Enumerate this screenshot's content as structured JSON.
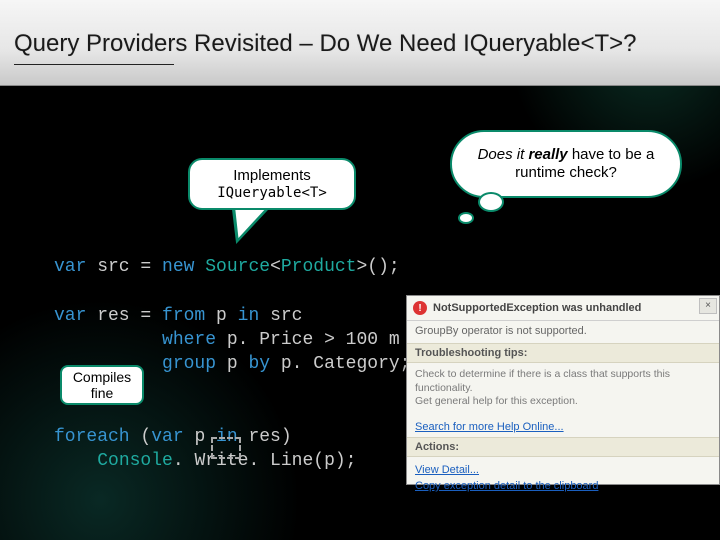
{
  "title": "Query Providers Revisited – Do We Need IQueryable<T>?",
  "bubble_implements": {
    "line1": "Implements",
    "line2": "IQueryable<T>"
  },
  "thought": {
    "text_prefix": "Does it ",
    "emph": "really",
    "text_suffix": " have to be a runtime check?"
  },
  "compiles_box": "Compiles fine",
  "code": {
    "l1_var": "var",
    "l1_rest": " src = ",
    "l1_new": "new",
    "l1_sp": " ",
    "l1_type": "Source",
    "l1_lt": "<",
    "l1_prod": "Product",
    "l1_end": ">();",
    "l2_var": "var",
    "l2_rest": " res = ",
    "l2_from": "from",
    "l2_a": " p ",
    "l2_in": "in",
    "l2_b": " src",
    "l3_pad": "          ",
    "l3_where": "where",
    "l3_rest": " p. Price > 100 m",
    "l4_pad": "          ",
    "l4_group": "group",
    "l4_a": " p ",
    "l4_by": "by",
    "l4_rest": " p. Category;",
    "l5_foreach": "foreach",
    "l5_rest": " (",
    "l5_var": "var",
    "l5_r2": " p ",
    "l5_in": "in",
    "l5_r3": " res)",
    "l6_pad": "    ",
    "l6_type": "Console",
    "l6_rest": ". Write. Line(p);"
  },
  "error_popup": {
    "title": "NotSupportedException was unhandled",
    "message": "GroupBy operator is not supported.",
    "tips_header": "Troubleshooting tips:",
    "tip1": "Check to determine if there is a class that supports this functionality.",
    "tip2": "Get general help for this exception.",
    "search_link": "Search for more Help Online...",
    "actions_header": "Actions:",
    "action1": "View Detail...",
    "action2": "Copy exception detail to the clipboard",
    "close_glyph": "×"
  }
}
